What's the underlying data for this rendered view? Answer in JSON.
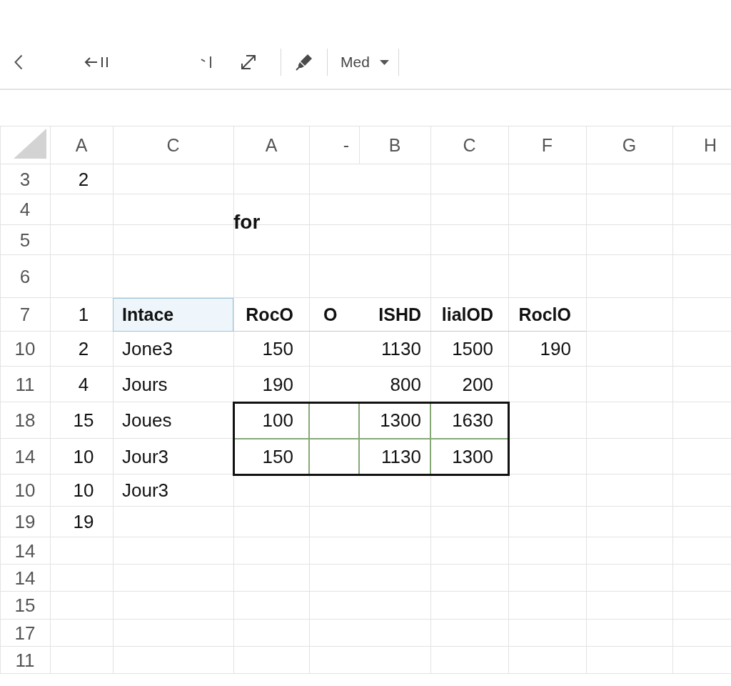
{
  "toolbar": {
    "size_menu": {
      "value": "Med"
    }
  },
  "sheet": {
    "columns": [
      {
        "label": "A",
        "joined": false
      },
      {
        "label": "C",
        "joined": false
      },
      {
        "label": "A",
        "joined": false
      },
      {
        "label": "-",
        "joined": false
      },
      {
        "label": "B",
        "joined": true
      },
      {
        "label": "C",
        "joined": false
      },
      {
        "label": "F",
        "joined": false
      },
      {
        "label": "G",
        "joined": false
      },
      {
        "label": "H",
        "joined": false
      }
    ],
    "floating_text": "for",
    "rows": [
      {
        "label": "3",
        "cells": [
          {
            "text": "2",
            "kind": "value",
            "selected": false,
            "active": false
          }
        ]
      },
      {
        "label": "4"
      },
      {
        "label": "5"
      },
      {
        "label": "6"
      },
      {
        "label": "7",
        "cells": [
          {
            "text": "1",
            "kind": "value",
            "selected": false,
            "active": false
          },
          {
            "text": "Intace",
            "kind": "heading",
            "selected": false,
            "active": true
          },
          {
            "text": "RocO",
            "kind": "heading",
            "selected": false,
            "active": false
          },
          {
            "text": "O",
            "kind": "heading",
            "selected": false,
            "active": false
          },
          {
            "text": "ISHD",
            "kind": "heading",
            "selected": false,
            "active": false
          },
          {
            "text": "lialOD",
            "kind": "heading",
            "selected": false,
            "active": false
          },
          {
            "text": "RoclO",
            "kind": "heading",
            "selected": false,
            "active": false
          }
        ]
      },
      {
        "label": "10",
        "cells": [
          {
            "text": "2",
            "kind": "value",
            "selected": false,
            "active": false
          },
          {
            "text": "Jone3",
            "kind": "value",
            "selected": false,
            "active": false
          },
          {
            "text": "150",
            "kind": "value",
            "selected": false,
            "active": false
          },
          {
            "selected": false,
            "active": false
          },
          {
            "text": "1130",
            "kind": "value",
            "selected": false,
            "active": false
          },
          {
            "text": "1500",
            "kind": "value",
            "selected": false,
            "active": false
          },
          {
            "text": "190",
            "kind": "value",
            "selected": false,
            "active": false
          }
        ]
      },
      {
        "label": "11",
        "cells": [
          {
            "text": "4",
            "kind": "value",
            "selected": false,
            "active": false
          },
          {
            "text": "Jours",
            "kind": "value",
            "selected": false,
            "active": false
          },
          {
            "text": "190",
            "kind": "value",
            "selected": false,
            "active": false
          },
          {
            "selected": false,
            "active": false
          },
          {
            "text": "800",
            "kind": "value",
            "selected": false,
            "active": false
          },
          {
            "text": "200",
            "kind": "value",
            "selected": false,
            "active": false
          }
        ]
      },
      {
        "label": "18",
        "cells": [
          {
            "text": "15",
            "kind": "value",
            "selected": false,
            "active": false
          },
          {
            "text": "Joues",
            "kind": "value",
            "selected": false,
            "active": false
          },
          {
            "text": "100",
            "kind": "value",
            "selected": true,
            "active": false
          },
          {
            "selected": true,
            "active": false
          },
          {
            "text": "1300",
            "kind": "value",
            "selected": true,
            "active": false
          },
          {
            "text": "1630",
            "kind": "value",
            "selected": true,
            "active": false
          }
        ]
      },
      {
        "label": "14",
        "cells": [
          {
            "text": "10",
            "kind": "value",
            "selected": false,
            "active": false
          },
          {
            "text": "Jour3",
            "kind": "value",
            "selected": false,
            "active": false
          },
          {
            "text": "150",
            "kind": "value",
            "selected": true,
            "active": false
          },
          {
            "selected": true,
            "active": false
          },
          {
            "text": "1130",
            "kind": "value",
            "selected": true,
            "active": false
          },
          {
            "text": "1300",
            "kind": "value",
            "selected": true,
            "active": false
          }
        ]
      },
      {
        "label": "10",
        "cells": [
          {
            "text": "10",
            "kind": "value",
            "selected": false,
            "active": false
          },
          {
            "text": "Jour3",
            "kind": "value",
            "selected": false,
            "active": false
          }
        ]
      },
      {
        "label": "19",
        "cells": [
          {
            "text": "19",
            "kind": "value",
            "selected": false,
            "active": false
          }
        ]
      },
      {
        "label": "14"
      },
      {
        "label": "14"
      },
      {
        "label": "15"
      },
      {
        "label": "17"
      },
      {
        "label": "11"
      }
    ]
  }
}
